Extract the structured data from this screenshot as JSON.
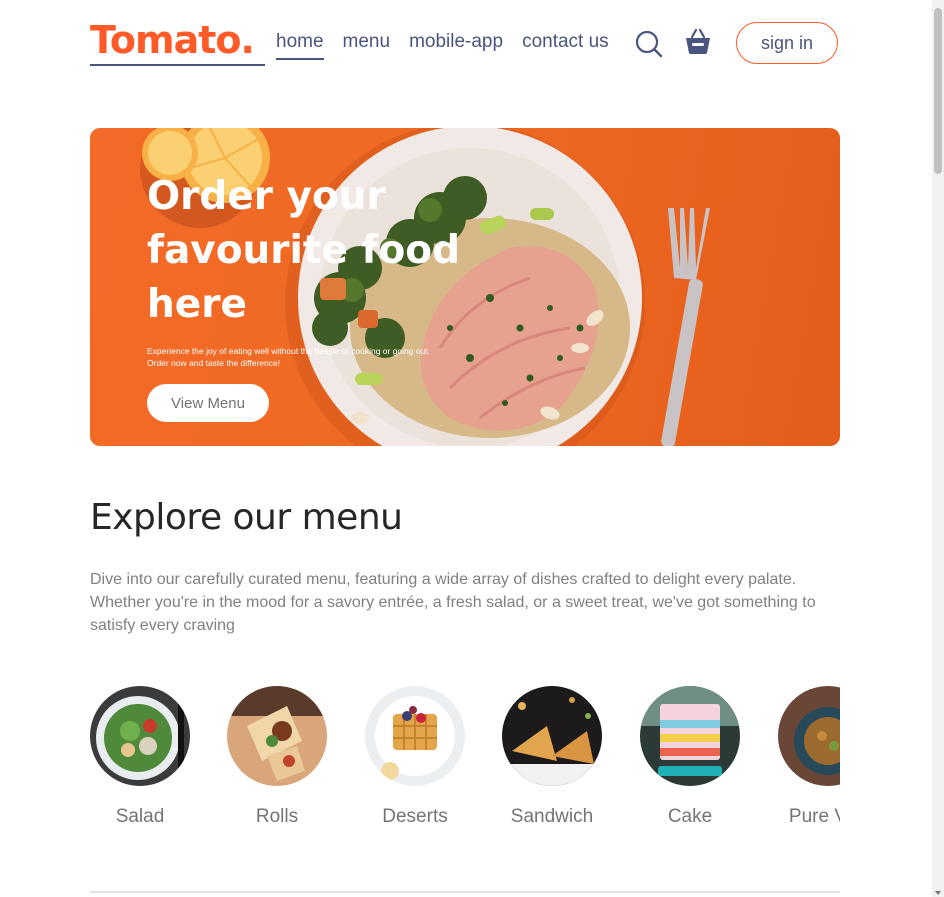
{
  "navbar": {
    "logo": "Tomato.",
    "links": [
      "home",
      "menu",
      "mobile-app",
      "contact us"
    ],
    "active_link": "home",
    "search_icon": "search-icon",
    "basket_icon": "basket-icon",
    "signin_label": "sign in"
  },
  "hero": {
    "title": "Order your favourite food here",
    "description_line1": "Experience the joy of eating well without the hassle of cooking or going out.",
    "description_line2": "Order now and taste the difference!",
    "button_label": "View Menu"
  },
  "explore": {
    "title": "Explore our menu",
    "text": "Dive into our carefully curated menu, featuring a wide array of dishes crafted to delight every palate. Whether you're in the mood for a savory entrée, a fresh salad, or a sweet treat, we've got something to satisfy every craving",
    "items": [
      {
        "label": "Salad"
      },
      {
        "label": "Rolls"
      },
      {
        "label": "Deserts"
      },
      {
        "label": "Sandwich"
      },
      {
        "label": "Cake"
      },
      {
        "label": "Pure Veg"
      }
    ]
  },
  "colors": {
    "brand": "#ff5a28",
    "text_dark": "#49557e",
    "hero_bg": "#ee6a22"
  }
}
